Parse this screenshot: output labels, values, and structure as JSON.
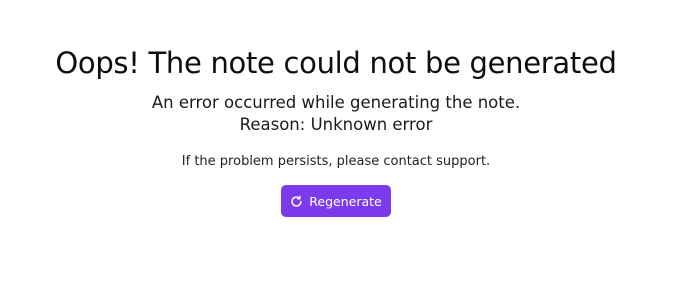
{
  "error": {
    "title": "Oops! The note could not be generated",
    "message_line1": "An error occurred while generating the note.",
    "message_line2": "Reason: Unknown error",
    "support_text": "If the problem persists, please contact support."
  },
  "actions": {
    "regenerate_label": "Regenerate",
    "regenerate_icon": "refresh-icon"
  },
  "colors": {
    "accent": "#7c3aed",
    "background": "#ffffff",
    "text": "#111111"
  }
}
